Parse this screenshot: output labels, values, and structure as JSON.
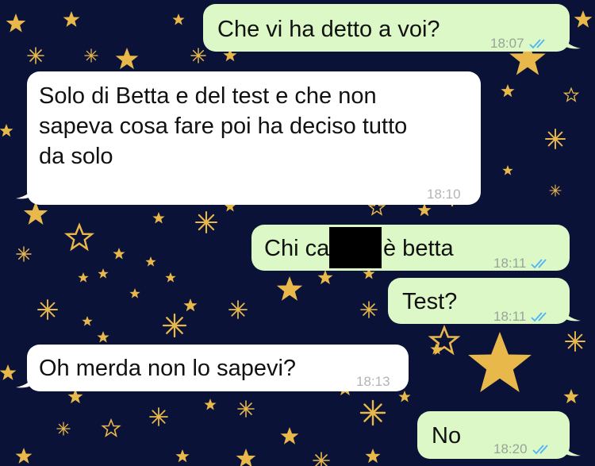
{
  "chat": {
    "wallpaper": "stars",
    "colors": {
      "outgoing": "#dcf8c6",
      "incoming": "#ffffff",
      "read_ticks": "#4fb3f6",
      "background": "#0b1238",
      "stars": "#e8b84a"
    },
    "messages": [
      {
        "direction": "out",
        "text": "Che vi ha detto a voi?",
        "time": "18:07",
        "status": "read"
      },
      {
        "direction": "in",
        "text": "Solo di Betta e del test e che non\nsapeva cosa fare poi ha deciso tutto\nda solo",
        "time": "18:10"
      },
      {
        "direction": "out",
        "text_before": "Chi ca",
        "text_after": "è betta",
        "redacted": true,
        "time": "18:11",
        "status": "read"
      },
      {
        "direction": "out",
        "text": "Test?",
        "time": "18:11",
        "status": "read"
      },
      {
        "direction": "in",
        "text": "Oh merda non lo sapevi?",
        "time": "18:13"
      },
      {
        "direction": "out",
        "text": "No",
        "time": "18:20",
        "status": "read"
      }
    ]
  }
}
